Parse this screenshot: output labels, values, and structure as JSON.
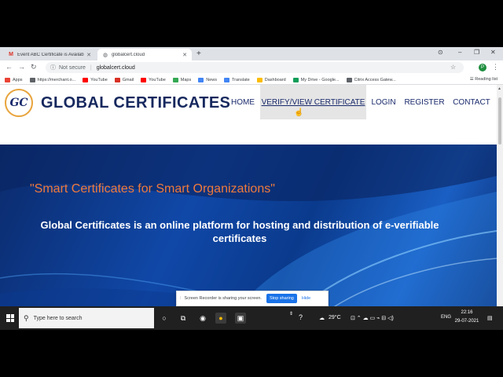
{
  "browser": {
    "tabs": [
      {
        "title": "Event ABC Certificate is Availabl",
        "active": false
      },
      {
        "title": "globalcert.cloud",
        "active": true
      }
    ],
    "new_tab": "+",
    "url": "globalcert.cloud",
    "security": "Not secure",
    "reading_list": "Reading list",
    "profile_initial": "P"
  },
  "bookmarks": [
    {
      "label": "Apps",
      "color": "#ea4335"
    },
    {
      "label": "https://merchant.o...",
      "color": "#5f6368"
    },
    {
      "label": "YouTube",
      "color": "#ff0000"
    },
    {
      "label": "Gmail",
      "color": "#d93025"
    },
    {
      "label": "YouTube",
      "color": "#ff0000"
    },
    {
      "label": "Maps",
      "color": "#34a853"
    },
    {
      "label": "News",
      "color": "#4285f4"
    },
    {
      "label": "Translate",
      "color": "#4285f4"
    },
    {
      "label": "Dashboard",
      "color": "#fbbc04"
    },
    {
      "label": "My Drive - Google...",
      "color": "#0f9d58"
    },
    {
      "label": "Citrix Access Gatew...",
      "color": "#5f6368"
    }
  ],
  "site": {
    "logo_text": "GC",
    "brand": "GLOBAL CERTIFICATES",
    "nav": {
      "home": "HOME",
      "verify": "VERIFY/VIEW CERTIFICATE",
      "login": "LOGIN",
      "register": "REGISTER",
      "contact": "CONTACT"
    },
    "hero": {
      "quote": "\"Smart Certificates for Smart Organizations\"",
      "description": "Global Certificates is an online platform for hosting and distribution of e-verifiable certificates"
    }
  },
  "share_banner": {
    "message": "Screen Recorder is sharing your screen.",
    "stop": "Stop sharing",
    "hide": "Hide"
  },
  "taskbar": {
    "search_placeholder": "Type here to search",
    "temperature": "29°C",
    "language": "ENG",
    "time": "22:16",
    "date": "29-07-2021"
  },
  "colors": {
    "brand": "#16285e",
    "accent": "#f07a3c",
    "logo_ring": "#e8a43c",
    "hero_blue": "#1048a8"
  }
}
